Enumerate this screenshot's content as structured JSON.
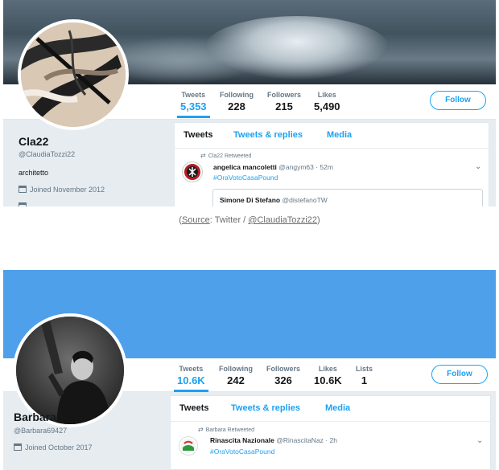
{
  "profile1": {
    "name": "Cla22",
    "handle": "@ClaudiaTozzi22",
    "bio": "architetto",
    "joined": "Joined November 2012",
    "stats": [
      {
        "label": "Tweets",
        "value": "5,353"
      },
      {
        "label": "Following",
        "value": "228"
      },
      {
        "label": "Followers",
        "value": "215"
      },
      {
        "label": "Likes",
        "value": "5,490"
      }
    ],
    "follow_label": "Follow",
    "tabs": [
      "Tweets",
      "Tweets & replies",
      "Media"
    ],
    "tweet": {
      "retweet_text": "Cla22 Retweeted",
      "author_name": "angelica mancoletti",
      "author_handle": "@angym63 · 52m",
      "hashtag": "#OraVotoCasaPound",
      "quote_name": "Simone Di Stefano",
      "quote_handle": "@distefanoTW"
    }
  },
  "caption": {
    "open": "(",
    "source": "Source",
    "middle": ": Twitter / ",
    "account": "@ClaudiaTozzi22",
    "close": ")"
  },
  "profile2": {
    "name": "Barbara",
    "handle": "@Barbara69427",
    "joined": "Joined October 2017",
    "stats": [
      {
        "label": "Tweets",
        "value": "10.6K"
      },
      {
        "label": "Following",
        "value": "242"
      },
      {
        "label": "Followers",
        "value": "326"
      },
      {
        "label": "Likes",
        "value": "10.6K"
      },
      {
        "label": "Lists",
        "value": "1"
      }
    ],
    "follow_label": "Follow",
    "tabs": [
      "Tweets",
      "Tweets & replies",
      "Media"
    ],
    "tweet": {
      "retweet_text": "Barbara Retweeted",
      "author_name": "Rinascita Nazionale",
      "author_handle": "@RinascitaNaz · 2h",
      "hashtag": "#OraVotoCasaPound"
    }
  },
  "icons": {
    "calendar": "calendar-icon",
    "retweet": "retweet-icon",
    "chevron": "chevron-down-icon"
  },
  "colors": {
    "accent": "#1da1f2",
    "banner2": "#4ea0ea"
  }
}
